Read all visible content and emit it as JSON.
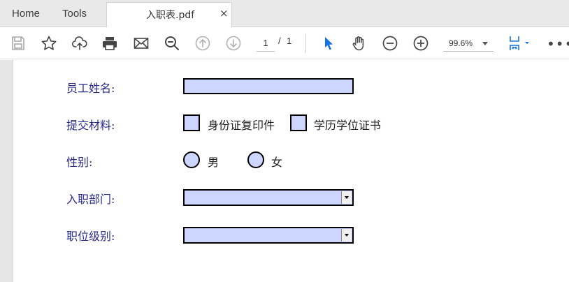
{
  "tabs": {
    "home": "Home",
    "tools": "Tools",
    "document": "入职表.pdf",
    "close": "×"
  },
  "toolbar": {
    "icons": [
      "save-icon",
      "star-icon",
      "upload-cloud-icon",
      "print-icon",
      "mail-icon",
      "zoom-search-icon",
      "page-up-icon",
      "page-down-icon",
      "select-pointer-icon",
      "hand-icon",
      "zoom-out-icon",
      "zoom-in-icon",
      "fit-page-icon",
      "more-icon"
    ],
    "page_current": "1",
    "page_sep": "/",
    "page_total": "1",
    "zoom": "99.6%",
    "more": "•••",
    "accent": "#1473e6"
  },
  "form": {
    "name_label": "员工姓名:",
    "materials_label": "提交材料:",
    "material_1": "身份证复印件",
    "material_2": "学历学位证书",
    "gender_label": "性别:",
    "gender_male": "男",
    "gender_female": "女",
    "department_label": "入职部门:",
    "level_label": "职位级别:",
    "field_color": "#ccd6ff",
    "label_color": "#2a2a8a"
  }
}
